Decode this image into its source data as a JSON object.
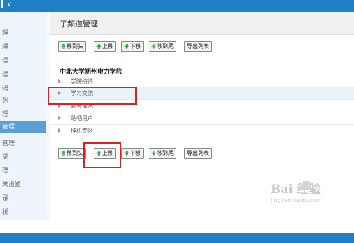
{
  "topbar": {
    "glyph": "▎∨"
  },
  "sidebar": {
    "items": [
      {
        "label": "理",
        "active": false
      },
      {
        "label": "理",
        "active": false
      },
      {
        "label": "理",
        "active": false
      },
      {
        "label": "理",
        "active": false
      },
      {
        "label": "码",
        "active": false
      },
      {
        "label": "列",
        "active": false
      },
      {
        "label": "理",
        "active": false
      },
      {
        "label": "管理",
        "active": true
      },
      {
        "label": "管理",
        "active": false
      },
      {
        "label": "录",
        "active": false
      },
      {
        "label": "理",
        "active": false
      },
      {
        "label": "关设置",
        "active": false
      },
      {
        "label": "录",
        "active": false
      },
      {
        "label": "析",
        "active": false
      }
    ]
  },
  "panel": {
    "title": "子频道管理",
    "toolbar": {
      "move_top": "移到头",
      "move_up": "上移",
      "move_down": "下移",
      "move_bottom": "移到尾",
      "export": "导出列表"
    },
    "school": "中北大学朔州电力学院",
    "channels": [
      {
        "label": "学院接待",
        "highlight": false
      },
      {
        "label": "学习交流",
        "highlight": true
      },
      {
        "label": "聊天灌水",
        "highlight": false
      },
      {
        "label": "贴吧用户",
        "highlight": false
      },
      {
        "label": "挂机专区",
        "highlight": false
      }
    ]
  },
  "watermark": {
    "main": "Bai 经验",
    "sub": "jingyan.baidu.com"
  },
  "colors": {
    "topbar": "#1f7fc7",
    "highlight_box": "#e02020",
    "active_sidebar": "#5b9fd8"
  }
}
